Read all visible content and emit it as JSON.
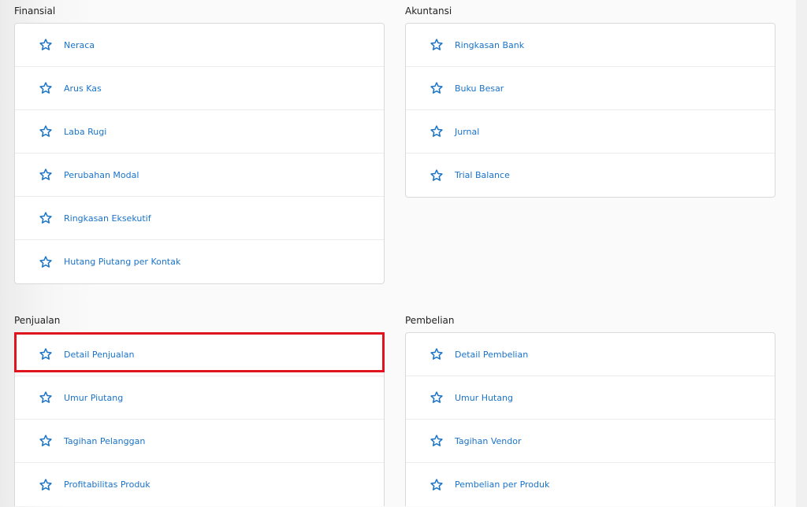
{
  "sections": {
    "finansial": {
      "title": "Finansial",
      "items": [
        "Neraca",
        "Arus Kas",
        "Laba Rugi",
        "Perubahan Modal",
        "Ringkasan Eksekutif",
        "Hutang Piutang per Kontak"
      ]
    },
    "akuntansi": {
      "title": "Akuntansi",
      "items": [
        "Ringkasan Bank",
        "Buku Besar",
        "Jurnal",
        "Trial Balance"
      ]
    },
    "penjualan": {
      "title": "Penjualan",
      "items": [
        "Detail Penjualan",
        "Umur Piutang",
        "Tagihan Pelanggan",
        "Profitabilitas Produk"
      ]
    },
    "pembelian": {
      "title": "Pembelian",
      "items": [
        "Detail Pembelian",
        "Umur Hutang",
        "Tagihan Vendor",
        "Pembelian per Produk"
      ]
    }
  },
  "icon": "star-outline-icon",
  "colors": {
    "link": "#1a73c8",
    "highlight": "#e0141e"
  }
}
